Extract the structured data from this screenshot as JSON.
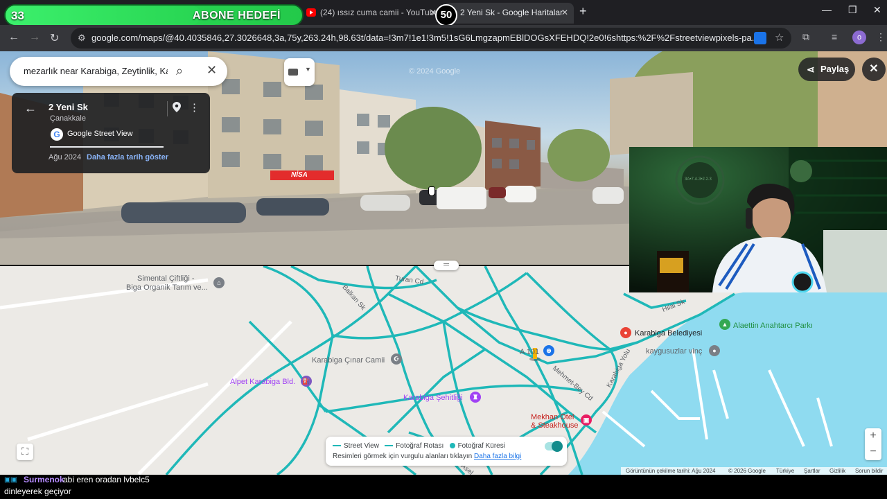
{
  "stream_overlay": {
    "subgoal_current": "33",
    "subgoal_label": "ABONE HEDEFİ",
    "subgoal_target": "50",
    "subgoal_progress": 0.66
  },
  "browser": {
    "tabs": [
      {
        "title": "(24) ıssız cuma camii - YouTube",
        "active": false
      },
      {
        "title": "2 Yeni Sk - Google Haritalar",
        "active": true
      }
    ],
    "url": "google.com/maps/@40.4035846,27.3026648,3a,75y,263.24h,98.63t/data=!3m7!1e1!3m5!1sG6LmgzapmEBlDOGsXFEHDQ!2e0!6shttps:%2F%2Fstreetviewpixels-pa.googleapis.com%2..."
  },
  "search": {
    "query": "mezarlık near Karabiga, Zeytinlik, Karabiga"
  },
  "info_card": {
    "title": "2 Yeni Sk",
    "subtitle": "Çanakkale",
    "provider": "Google Street View",
    "date": "Ağu 2024",
    "more_dates_link": "Daha fazla tarih göster"
  },
  "street_view": {
    "share_label": "Paylaş",
    "shop_sign": "NİSA"
  },
  "map": {
    "labels": {
      "simental": "Simental Çiftliği -",
      "biga_organik": "Biga Organik Tarım ve...",
      "turan_cd": "Turan Cd",
      "balkan_sk": "Balkan Sk",
      "hilal_sk": "Hilal Sk",
      "karabiga_belediyesi": "Karabiga Belediyesi",
      "alaettin_parki": "Alaettin Anahtarcı Parkı",
      "kaygusuzlar": "kaygusuzlar vinç",
      "cinar_camii": "Karabiga Çınar Camii",
      "a101": "A 101",
      "mehmet_bey": "Mehmet-Bey Cd",
      "karabiga_yolu": "Karabiga Yolu",
      "alpet": "Alpet Karabiga Bld.",
      "sehitligi": "Karabiga Şehitliği",
      "mekhan_otel": "Mekhan Otel",
      "steakhouse": "& Steakhouse",
      "asel": "Asel"
    },
    "legend": {
      "street_view": "Street View",
      "photo_route": "Fotoğraf Rotası",
      "photo_sphere": "Fotoğraf Küresi",
      "hint": "Resimleri görmek için vurgulu alanları tıklayın",
      "more_info": "Daha fazla bilgi"
    },
    "footer": {
      "capture_date": "Görüntünün çekilme tarihi: Ağu 2024",
      "copyright": "© 2026 Google",
      "country": "Türkiye",
      "terms": "Şartlar",
      "privacy": "Gizlilik",
      "report": "Sorun bildir"
    },
    "colors": {
      "street_view_line": "#1fb8b8",
      "sea": "#8fdbf0",
      "land": "#eceae6"
    }
  },
  "webcam": {
    "wall_logo_text": "3A•7.A.3•2.2.3"
  },
  "chat": {
    "user": "Surmenok",
    "message_line1": "abi eren oradan lvbelc5",
    "message_line2": "dinleyerek geçiyor"
  }
}
